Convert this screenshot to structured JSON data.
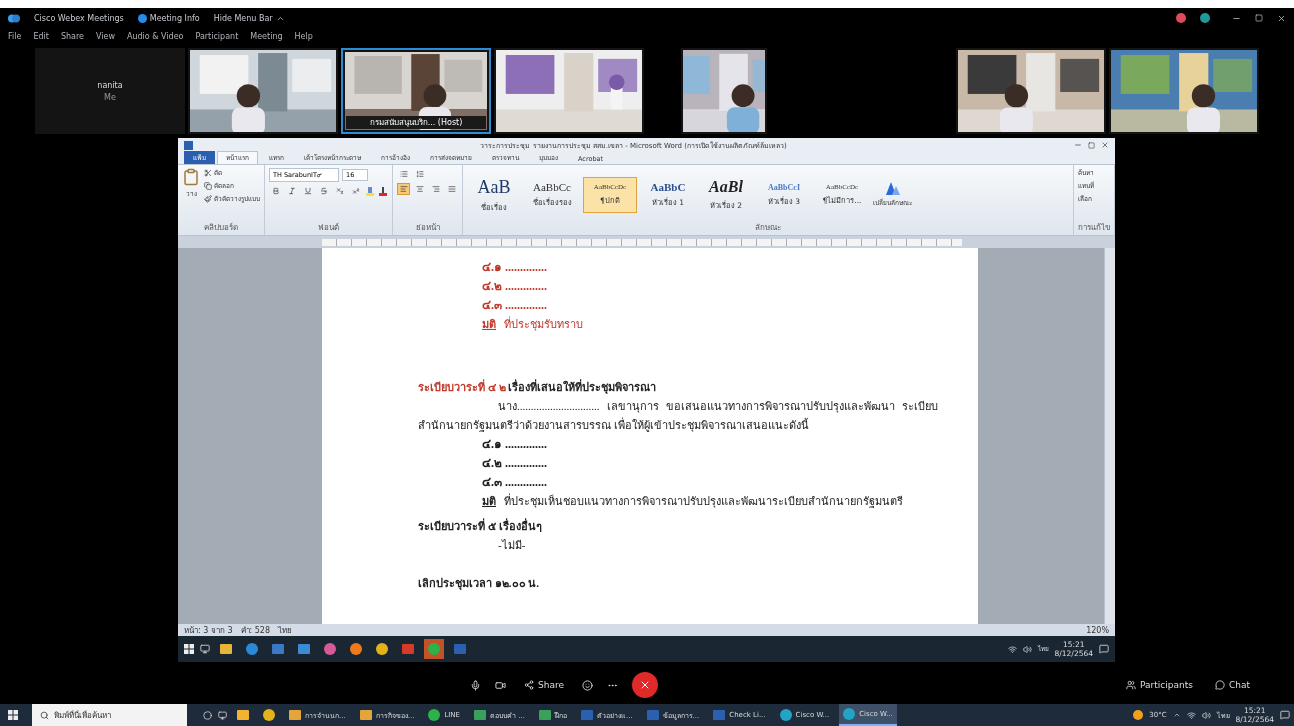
{
  "app": {
    "title": "Cisco Webex Meetings",
    "meeting_info": "Meeting Info",
    "hide_menu": "Hide Menu Bar"
  },
  "menu": [
    "File",
    "Edit",
    "Share",
    "View",
    "Audio & Video",
    "Participant",
    "Meeting",
    "Help"
  ],
  "video_groups": [
    [
      {
        "kind": "avatar",
        "name": "nanita",
        "sub": "Me",
        "selected": false
      },
      {
        "kind": "picture",
        "selected": false
      },
      {
        "kind": "picture",
        "label": "กรมสนับสนุนบริก... (Host)",
        "selected": true
      },
      {
        "kind": "picture",
        "selected": false
      }
    ],
    [
      {
        "kind": "picture",
        "selected": false
      }
    ],
    [
      {
        "kind": "picture",
        "selected": false
      },
      {
        "kind": "picture",
        "selected": false
      }
    ]
  ],
  "word": {
    "title": "วาระการประชุม รายงานการประชุม สสม.เขลา - Microsoft Word (การเปิดใช้งานผลิตภัณฑ์ล้มเหลว)",
    "tabs": [
      {
        "label": "แฟ้ม",
        "selected": false,
        "kind": "file"
      },
      {
        "label": "หน้าแรก",
        "selected": true,
        "kind": "tab"
      },
      {
        "label": "แทรก",
        "selected": false,
        "kind": "tab"
      },
      {
        "label": "เค้าโครงหน้ากระดาษ",
        "selected": false,
        "kind": "tab"
      },
      {
        "label": "การอ้างอิง",
        "selected": false,
        "kind": "tab"
      },
      {
        "label": "การส่งจดหมาย",
        "selected": false,
        "kind": "tab"
      },
      {
        "label": "ตรวจทาน",
        "selected": false,
        "kind": "tab"
      },
      {
        "label": "มุมมอง",
        "selected": false,
        "kind": "tab"
      },
      {
        "label": "Acrobat",
        "selected": false,
        "kind": "tab"
      }
    ],
    "clipboard": {
      "paste": "วาง",
      "items": [
        "ตัด",
        "คัดลอก",
        "ตัวคัดวางรูปแบบ"
      ],
      "label": "คลิปบอร์ด"
    },
    "font": {
      "name": "TH SarabunIT๙",
      "size": "16",
      "label": "ฟอนต์"
    },
    "paragraph": {
      "label": "ย่อหน้า",
      "alignments": [
        {
          "selected": true
        },
        {
          "selected": false
        },
        {
          "selected": false
        },
        {
          "selected": false
        }
      ]
    },
    "styles": {
      "label": "ลักษณะ",
      "items": [
        {
          "sample": "AaB",
          "name": "ชื่อเรื่อง",
          "selected": false
        },
        {
          "sample": "AaBbCc",
          "name": "ชื่อเรื่องรอง",
          "selected": false
        },
        {
          "sample": "AaBbCcDc",
          "name": "¶ปกติ",
          "selected": true
        },
        {
          "sample": "AaBbC",
          "name": "หัวเรื่อง 1",
          "selected": false
        },
        {
          "sample": "AaBl",
          "name": "หัวเรื่อง 2",
          "selected": false
        },
        {
          "sample": "AaBbCcI",
          "name": "หัวเรื่อง 3",
          "selected": false
        },
        {
          "sample": "AaBbCcDc",
          "name": "¶ไม่มีการ...",
          "selected": false
        }
      ],
      "change": "เปลี่ยนลักษณะ"
    },
    "editing": {
      "label": "การแก้ไข",
      "items": [
        "ค้นหา",
        "แทนที่",
        "เลือก"
      ]
    },
    "page": [
      {
        "kind": "item",
        "text": "๔.๑ ..............",
        "color": "#c0392b"
      },
      {
        "kind": "item",
        "text": "๔.๒ ..............",
        "color": "#c0392b"
      },
      {
        "kind": "item",
        "text": "๔.๓ ..............",
        "color": "#c0392b"
      },
      {
        "kind": "resolution",
        "label": "มติ",
        "text": "ที่ประชุมรับทราบ",
        "color": "#c0392b"
      },
      {
        "kind": "blank"
      },
      {
        "kind": "blank"
      },
      {
        "kind": "heading",
        "prefix": "ระเบียบวาระที่ ๔ ๒",
        "title": "เรื่องที่เสนอให้ที่ประชุมพิจารณา",
        "color": "#c0392b"
      },
      {
        "kind": "para",
        "text": "นาง.............................. เลขานุการ ขอเสนอแนวทางการพิจารณาปรับปรุงและพัฒนา ระเบียบสำนักนายกรัฐมนตรีว่าด้วยงานสารบรรณ เพื่อให้ผู้เข้าประชุมพิจารณาเสนอแนะดังนี้"
      },
      {
        "kind": "item",
        "text": "๔.๑ ..............",
        "color": "#222222"
      },
      {
        "kind": "item",
        "text": "๔.๒ ..............",
        "color": "#222222"
      },
      {
        "kind": "item",
        "text": "๔.๓ ..............",
        "color": "#222222"
      },
      {
        "kind": "resolution",
        "label": "มติ",
        "text": "ที่ประชุมเห็นชอบแนวทางการพิจารณาปรับปรุงและพัฒนาระเบียบสำนักนายกรัฐมนตรี",
        "color": "#222222"
      },
      {
        "kind": "heading",
        "prefix": "ระเบียบวาระที่ ๕",
        "title": "เรื่องอื่นๆ",
        "color": "#222222"
      },
      {
        "kind": "plain",
        "text": "-ไม่มี-"
      },
      {
        "kind": "blank"
      },
      {
        "kind": "closing",
        "text": "เลิกประชุมเวลา ๑๒.๐๐ น."
      }
    ],
    "status": [
      "หน้า: 3 จาก 3",
      "คำ: 528",
      "ไทย"
    ],
    "zoom": "120%"
  },
  "inner_taskbar": {
    "apps": [
      {
        "kind": "explorer",
        "selected": false
      },
      {
        "kind": "edge",
        "selected": false
      },
      {
        "kind": "store",
        "selected": false
      },
      {
        "kind": "mail",
        "selected": false
      },
      {
        "kind": "photos",
        "selected": false
      },
      {
        "kind": "firefox",
        "selected": false
      },
      {
        "kind": "chrome",
        "selected": false
      },
      {
        "kind": "pdf",
        "selected": false
      },
      {
        "kind": "line",
        "selected": true
      },
      {
        "kind": "word",
        "selected": false
      }
    ],
    "lang": "ไทย",
    "time": "15:21",
    "date": "8/12/2564"
  },
  "controls": {
    "share": "Share",
    "participants": "Participants",
    "chat": "Chat"
  },
  "taskbar": {
    "search": "พิมพ์ที่นี่เพื่อค้นหา",
    "apps": [
      {
        "kind": "sticky",
        "selected": false
      },
      {
        "kind": "chrome",
        "selected": false
      },
      {
        "kind": "folder",
        "label": "การจำนนก...",
        "selected": false
      },
      {
        "kind": "folder",
        "label": "การกิจของ...",
        "selected": false
      },
      {
        "kind": "line",
        "label": "LINE",
        "selected": false
      },
      {
        "kind": "teams",
        "label": "ตอบบคำ ...",
        "selected": false
      },
      {
        "kind": "teams",
        "label": "ฝึกอ",
        "selected": false
      },
      {
        "kind": "word",
        "label": "ตัวอย่างแ...",
        "selected": false
      },
      {
        "kind": "word",
        "label": "ข้อมูลการ...",
        "selected": false
      },
      {
        "kind": "word",
        "label": "Check Li...",
        "selected": false
      },
      {
        "kind": "webex",
        "label": "Cisco W...",
        "selected": false
      },
      {
        "kind": "webex",
        "label": "Cisco W...",
        "selected": true
      }
    ],
    "weather": "30°C",
    "lang": "ไทย",
    "time": "15:21",
    "date": "8/12/2564"
  }
}
